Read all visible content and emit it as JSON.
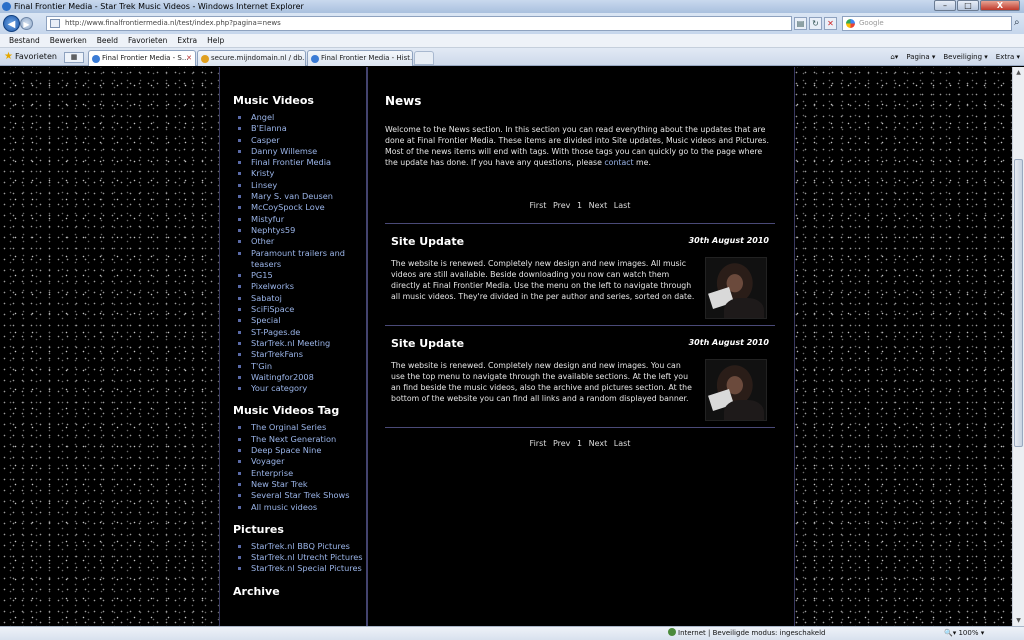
{
  "window": {
    "title": "Final Frontier Media - Star Trek Music Videos - Windows Internet Explorer",
    "min": "–",
    "max": "□",
    "close": "X"
  },
  "address": {
    "url": "http://www.finalfrontiermedia.nl/test/index.php?pagina=news"
  },
  "search": {
    "placeholder": "Google"
  },
  "menu": [
    "Bestand",
    "Bewerken",
    "Beeld",
    "Favorieten",
    "Extra",
    "Help"
  ],
  "favorites": {
    "label": "Favorieten"
  },
  "tabs": [
    {
      "label": "Final Frontier Media - S...",
      "close": "✕"
    },
    {
      "label": "secure.mijndomain.nl / db..."
    },
    {
      "label": "Final Frontier Media - Hist..."
    }
  ],
  "commandbar": {
    "page": "Pagina ▾",
    "security": "Beveiliging ▾",
    "tools": "Extra ▾"
  },
  "sidebar": {
    "sections": [
      {
        "title": "Music Videos",
        "items": [
          "Angel",
          "B'Elanna",
          "Casper",
          "Danny Willemse",
          "Final Frontier Media",
          "Kristy",
          "Linsey",
          "Mary S. van Deusen",
          "McCoySpock Love",
          "Mistyfur",
          "Nephtys59",
          "Other",
          "Paramount trailers and teasers",
          "PG15",
          "Pixelworks",
          "Sabatoj",
          "SciFiSpace",
          "Special",
          "ST-Pages.de",
          "StarTrek.nl Meeting",
          "StarTrekFans",
          "T'Gin",
          "Waitingfor2008",
          "Your category"
        ]
      },
      {
        "title": "Music Videos Tag",
        "items": [
          "The Orginal Series",
          "The Next Generation",
          "Deep Space Nine",
          "Voyager",
          "Enterprise",
          "New Star Trek",
          "Several Star Trek Shows",
          "All music videos"
        ]
      },
      {
        "title": "Pictures",
        "items": [
          "StarTrek.nl BBQ Pictures",
          "StarTrek.nl Utrecht Pictures",
          "StarTrek.nl Special Pictures"
        ]
      },
      {
        "title": "Archive",
        "items": []
      }
    ]
  },
  "content": {
    "title": "News",
    "intro": "Welcome to the News section. In this section you can read everything about the updates that are done at Final Frontier Media. These items are divided into Site updates, Music videos and Pictures. Most of the news items will end with tags. With those tags you can quickly go to the page where the update has done. If you have any questions, please",
    "intro_link": "contact",
    "intro_end": " me.",
    "pager": {
      "first": "First",
      "prev": "Prev",
      "page": "1",
      "next": "Next",
      "last": "Last"
    },
    "news": [
      {
        "title": "Site Update",
        "date": "30th August 2010",
        "body": "The website is renewed. Completely new design and new images. All music videos are still available. Beside downloading you now can watch them directly at Final Frontier Media. Use the menu on the left to navigate through all music videos. They're divided in the per author and series, sorted on date."
      },
      {
        "title": "Site Update",
        "date": "30th August 2010",
        "body": "The website is renewed. Completely new design and new images. You can use the top menu to navigate through the available sections. At the left you an find beside the music videos, also the archive and pictures section. At the bottom of the website you can find all links and a random displayed banner."
      }
    ]
  },
  "status": {
    "zone": "Internet | Beveiligde modus: ingeschakeld",
    "zoom": "100%"
  }
}
